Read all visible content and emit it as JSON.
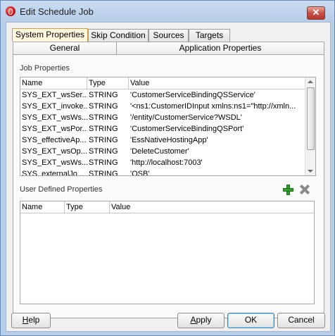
{
  "window": {
    "title": "Edit Schedule Job"
  },
  "tabs": [
    {
      "label": "System Properties"
    },
    {
      "label": "Skip Condition"
    },
    {
      "label": "Sources"
    },
    {
      "label": "Targets"
    }
  ],
  "subtabs": {
    "general": "General",
    "application": "Application Properties"
  },
  "job_properties": {
    "label": "Job Properties",
    "columns": [
      "Name",
      "Type",
      "Value"
    ],
    "rows": [
      {
        "name": "SYS_EXT_wsSer...",
        "type": "STRING",
        "value": "'CustomerServiceBindingQSService'"
      },
      {
        "name": "SYS_EXT_invoke...",
        "type": "STRING",
        "value": "'<ns1:CustomerIDInput xmlns:ns1=\"http://xmln..."
      },
      {
        "name": "SYS_EXT_wsWs...",
        "type": "STRING",
        "value": "'/entity/CustomerService?WSDL'"
      },
      {
        "name": "SYS_EXT_wsPor...",
        "type": "STRING",
        "value": "'CustomerServiceBindingQSPort'"
      },
      {
        "name": "SYS_effectiveAp...",
        "type": "STRING",
        "value": "'EssNativeHostingApp'"
      },
      {
        "name": "SYS_EXT_wsOp...",
        "type": "STRING",
        "value": "'DeleteCustomer'"
      },
      {
        "name": "SYS_EXT_wsWs...",
        "type": "STRING",
        "value": "'http://localhost:7003'"
      },
      {
        "name": "SYS_externalJo...",
        "type": "STRING",
        "value": "'OSB'"
      }
    ]
  },
  "user_defined": {
    "label": "User Defined Properties",
    "columns": [
      "Name",
      "Type",
      "Value"
    ],
    "add_icon": "add-icon",
    "delete_icon": "delete-icon"
  },
  "buttons": {
    "help": {
      "first": "H",
      "rest": "elp"
    },
    "apply": {
      "first": "A",
      "rest": "pply"
    },
    "ok": "OK",
    "cancel": "Cancel"
  }
}
